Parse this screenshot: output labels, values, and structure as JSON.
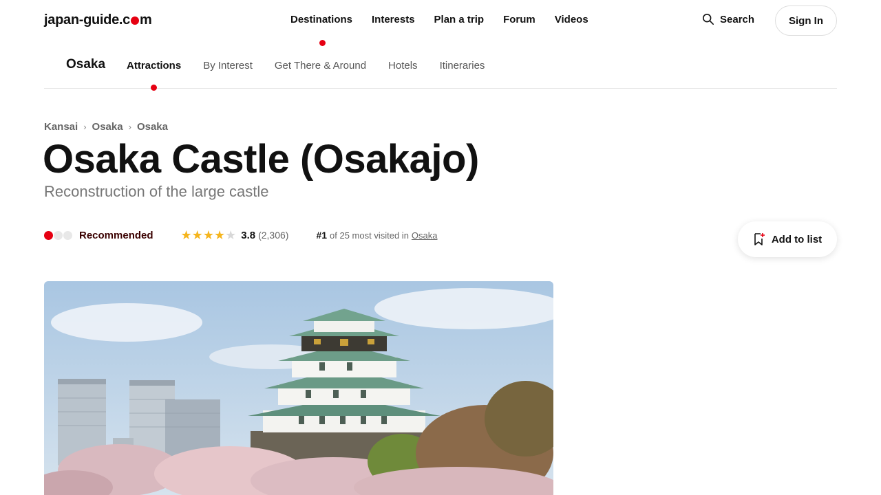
{
  "header": {
    "logo_part1": "japan-guide.c",
    "logo_part2": "m",
    "nav": [
      "Destinations",
      "Interests",
      "Plan a trip",
      "Forum",
      "Videos"
    ],
    "search_label": "Search",
    "signin_label": "Sign In"
  },
  "subnav": {
    "city": "Osaka",
    "tabs": [
      "Attractions",
      "By Interest",
      "Get There & Around",
      "Hotels",
      "Itineraries"
    ],
    "active_tab": "Attractions"
  },
  "breadcrumb": [
    "Kansai",
    "Osaka",
    "Osaka"
  ],
  "page": {
    "title": "Osaka Castle (Osakajo)",
    "subtitle": "Reconstruction of the large castle"
  },
  "meta": {
    "recommendation": "Recommended",
    "recommendation_level": 1,
    "recommendation_max": 3,
    "rating": "3.8",
    "rating_value": 3.8,
    "rating_count": "(2,306)",
    "rank": "#1",
    "rank_text": "of 25 most visited in",
    "rank_link": "Osaka"
  },
  "actions": {
    "add_to_list": "Add to list"
  },
  "colors": {
    "brand_red": "#e60012",
    "star": "#f5b51e"
  },
  "icons": {
    "search": "search-icon",
    "bookmark": "bookmark-plus-icon"
  }
}
